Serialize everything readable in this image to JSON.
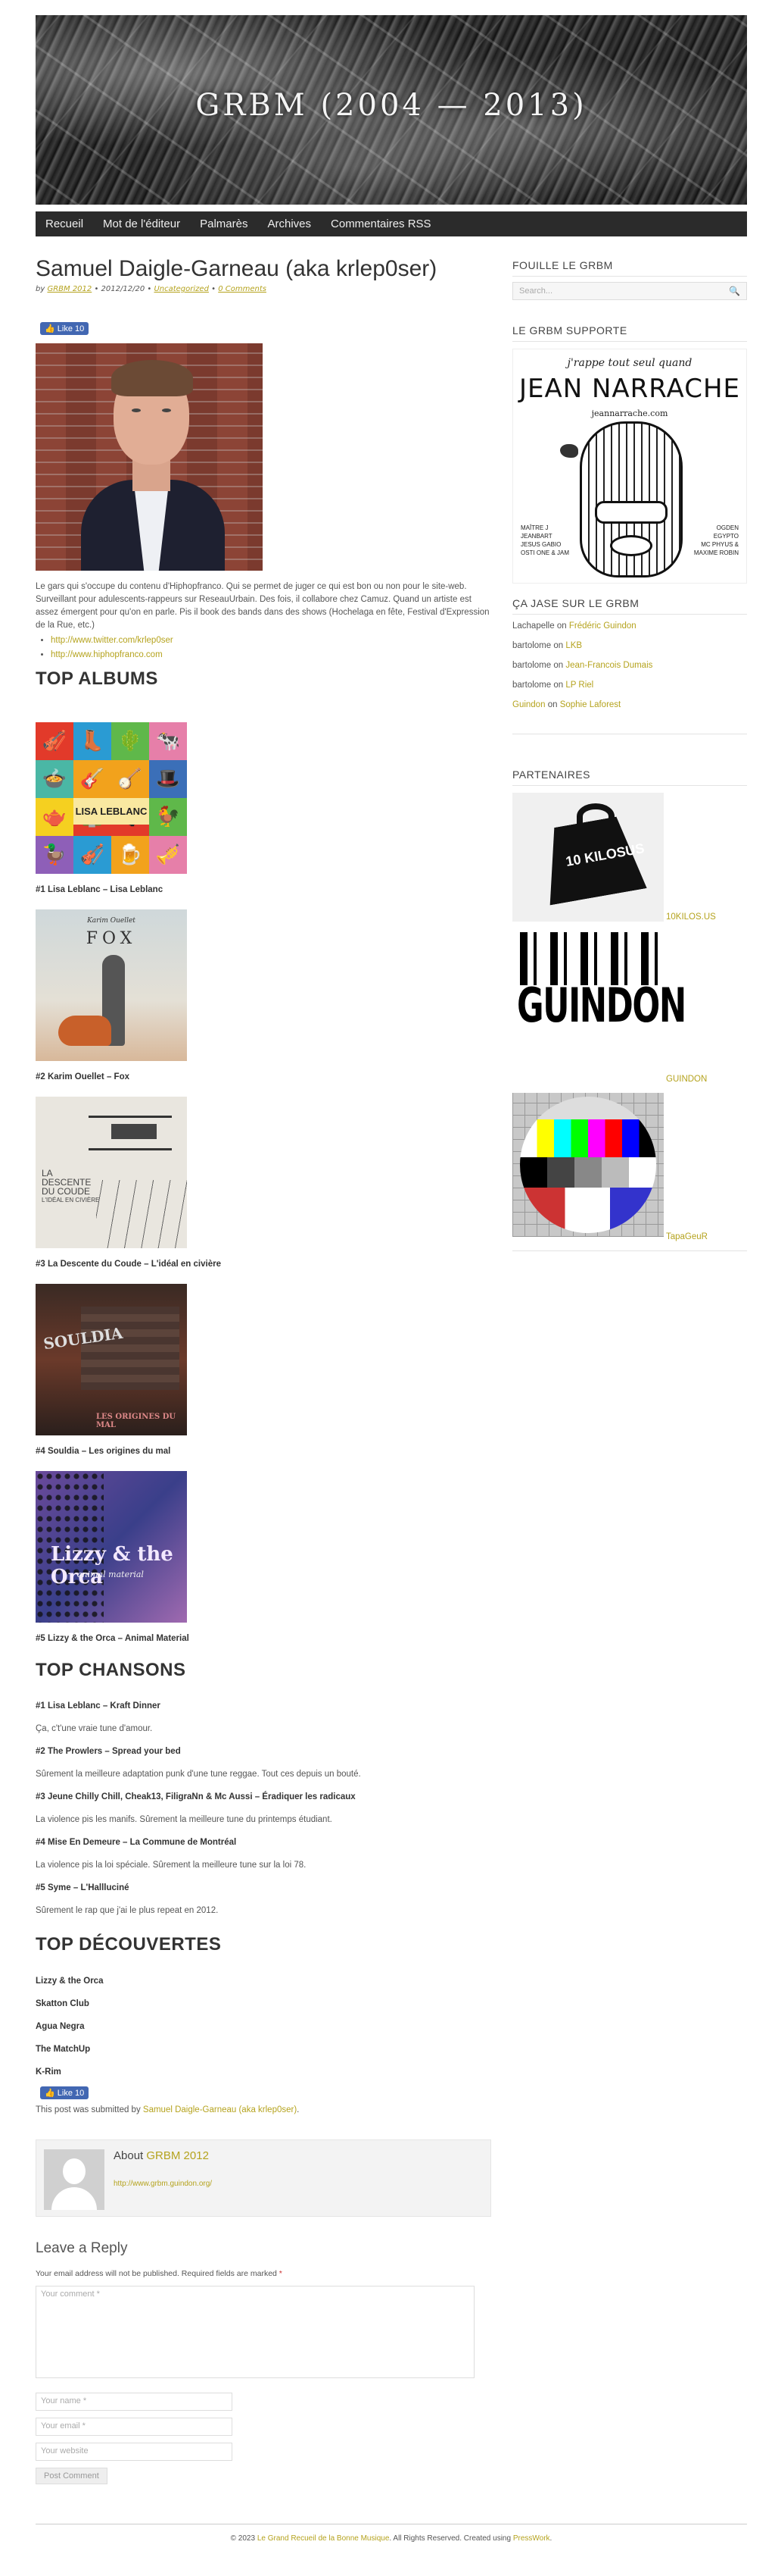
{
  "site": {
    "banner_title": "GRBM (2004 — 2013)"
  },
  "nav": {
    "items": [
      "Recueil",
      "Mot de l'éditeur",
      "Palmarès",
      "Archives",
      "Commentaires RSS"
    ]
  },
  "post": {
    "title": "Samuel Daigle-Garneau (aka krlep0ser)",
    "meta_by": "by",
    "meta_author": "GRBM 2012",
    "meta_date": "• 2012/12/20 •",
    "meta_category": "Uncategorized",
    "meta_sep": "•",
    "meta_comments": "0 Comments",
    "like_label": "👍 Like 10",
    "paragraph": "Le gars qui s'occupe du contenu d'Hiphopfranco. Qui se permet de juger ce qui est bon ou non pour le site-web. Surveillant pour adulescents-rappeurs sur ReseauUrbain. Des fois, il collabore chez Camuz. Quand un artiste est assez émergent pour qu'on en parle. Pis il book des bands dans des shows (Hochelaga en fête, Festival d'Expression de la Rue, etc.)",
    "links": [
      "http://www.twitter.com/krlep0ser",
      "http://www.hiphopfranco.com"
    ],
    "top_albums_heading": "TOP ALBUMS",
    "albums": [
      {
        "caption": "#1 Lisa Leblanc – Lisa Leblanc",
        "cover_text": "LISA LEBLANC"
      },
      {
        "caption": "#2 Karim Ouellet – Fox",
        "cover_small": "Karim Ouellet",
        "cover_big": "FOX"
      },
      {
        "caption": "#3 La Descente du Coude – L'idéal en civière",
        "cover_big": "LA DESCENTE DU COUDE",
        "cover_small": "L'IDÉAL EN CIVIÈRE"
      },
      {
        "caption": "#4 Souldia – Les origines du mal",
        "cover_big": "SOULDIA",
        "cover_small": "LES ORIGINES DU MAL"
      },
      {
        "caption": "#5 Lizzy & the Orca – Animal Material",
        "cover_big": "Lizzy & the Orca",
        "cover_small": "animal material"
      }
    ],
    "top_songs_heading": "TOP CHANSONS",
    "songs": [
      {
        "title": "#1 Lisa Leblanc – Kraft Dinner",
        "desc": "Ça, c't'une vraie tune d'amour."
      },
      {
        "title": "#2 The Prowlers – Spread your bed",
        "desc": "Sûrement la meilleure adaptation punk d'une tune reggae. Tout ces depuis un bouté."
      },
      {
        "title": "#3 Jeune Chilly Chill, Cheak13, FiligraNn & Mc Aussi – Éradiquer les radicaux",
        "desc": "La violence pis les manifs. Sûrement la meilleure tune du printemps étudiant."
      },
      {
        "title": "#4 Mise En Demeure – La Commune de Montréal",
        "desc": "La violence pis la loi spéciale. Sûrement la meilleure tune sur la loi 78."
      },
      {
        "title": "#5 Syme – L'Hallluciné",
        "desc": "Sûrement le rap que j'ai le plus repeat en 2012."
      }
    ],
    "top_discoveries_heading": "TOP DÉCOUVERTES",
    "discoveries": [
      "Lizzy & the Orca",
      "Skatton Club",
      "Agua Negra",
      "The MatchUp",
      "K-Rim"
    ],
    "submitted_prefix": "This post was submitted by",
    "submitted_author": "Samuel Daigle-Garneau (aka krlep0ser)",
    "submitted_suffix": "."
  },
  "author_box": {
    "about_prefix": "About",
    "about_name": "GRBM 2012",
    "url": "http://www.grbm.guindon.org/"
  },
  "reply": {
    "heading": "Leave a Reply",
    "note": "Your email address will not be published. Required fields are marked",
    "required_mark": "*",
    "comment_placeholder": "Your comment *",
    "name_placeholder": "Your name *",
    "email_placeholder": "Your email *",
    "website_placeholder": "Your website",
    "submit_label": "Post Comment"
  },
  "sidebar": {
    "search_title": "FOUILLE LE GRBM",
    "search_placeholder": "Search...",
    "supports_title": "LE GRBM SUPPORTE",
    "poster": {
      "top": "j'rappe tout seul quand",
      "name": "JEAN NARRACHE",
      "url": "jeannarrache.com",
      "left": "MAÎTRE J\nJEANBART\nJESUS GABIO\nOSTI ONE & JAM",
      "right": "OGDEN\nEGYPTO\nMC PHYUS &\nMAXIME ROBIN"
    },
    "comments_title": "ÇA JASE SUR LE GRBM",
    "comments": [
      {
        "who": "Lachapelle",
        "on": "on",
        "what": "Frédéric Guindon"
      },
      {
        "who": "bartolome",
        "on": "on",
        "what": "LKB"
      },
      {
        "who": "bartolome",
        "on": "on",
        "what": "Jean-Francois Dumais"
      },
      {
        "who": "bartolome",
        "on": "on",
        "what": "LP Riel"
      },
      {
        "who": "Guindon",
        "on": "on",
        "what": "Sophie Laforest"
      }
    ],
    "partners_title": "PARTENAIRES",
    "partners": [
      {
        "label": "10KILOS.US",
        "logo_text": "10 KILOSUS"
      },
      {
        "label": "GUINDON",
        "logo_text": "GUINDON"
      },
      {
        "label": "TapaGeuR",
        "logo_text": ""
      }
    ]
  },
  "footer": {
    "prefix": "© 2023",
    "site_link": "Le Grand Recueil de la Bonne Musique",
    "middle": ". All Rights Reserved. Created using",
    "theme_link": "PressWork",
    "suffix": "."
  }
}
